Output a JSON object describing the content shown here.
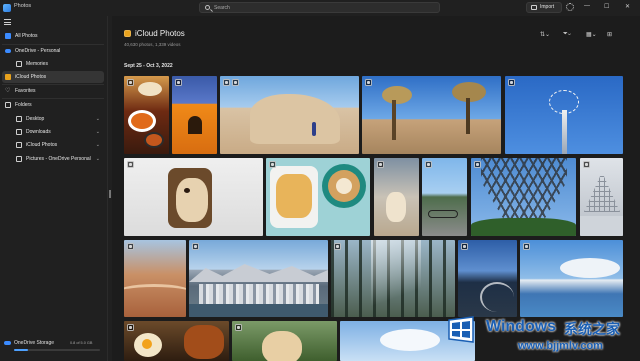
{
  "window": {
    "app_title": "Photos"
  },
  "search": {
    "placeholder": "Search"
  },
  "toolbar": {
    "import_label": "Import"
  },
  "sidebar": {
    "items": [
      {
        "label": "All Photos"
      },
      {
        "label": "OneDrive - Personal"
      },
      {
        "label": "Memories"
      },
      {
        "label": "iCloud Photos"
      },
      {
        "label": "Favorites"
      },
      {
        "label": "Folders"
      },
      {
        "label": "Desktop"
      },
      {
        "label": "Downloads"
      },
      {
        "label": "iCloud Photos"
      },
      {
        "label": "Pictures - OneDrive Personal"
      }
    ],
    "storage": {
      "label": "OneDrive Storage",
      "value": "0.8 of 5.0 GB",
      "fraction": 0.16
    }
  },
  "main": {
    "title": "iCloud Photos",
    "subtitle": "40,630 photos, 1,339 videos",
    "date_range": "Sept 25 - Oct 3, 2022"
  },
  "photos": [
    {
      "subject": "food-bowls",
      "badge": true
    },
    {
      "subject": "orange-building",
      "badge": true
    },
    {
      "subject": "desert-rocks",
      "badge": true,
      "badge2": true
    },
    {
      "subject": "joshua-tree",
      "badge": true
    },
    {
      "subject": "swing-ride",
      "badge": true
    },
    {
      "subject": "dog-on-chair",
      "badge": true
    },
    {
      "subject": "latte-art",
      "badge": true
    },
    {
      "subject": "dog-beach",
      "badge": true
    },
    {
      "subject": "bike-path",
      "badge": true
    },
    {
      "subject": "eiffel-tower",
      "badge": true
    },
    {
      "subject": "louvre-pyramid",
      "badge": true
    },
    {
      "subject": "canyon",
      "badge": true
    },
    {
      "subject": "city-skyline",
      "badge": true
    },
    {
      "subject": "forest-sunbeams",
      "badge": true
    },
    {
      "subject": "rocky-coast",
      "badge": true
    },
    {
      "subject": "lake-mountains",
      "badge": true
    },
    {
      "subject": "breakfast-plate",
      "badge": true
    },
    {
      "subject": "puppy-grass",
      "badge": true
    },
    {
      "subject": "sky-clouds",
      "badge": false
    }
  ],
  "watermark": {
    "brand": "Windows",
    "brand_cn": "系统之家",
    "url": "www.bjjmlv.com"
  }
}
